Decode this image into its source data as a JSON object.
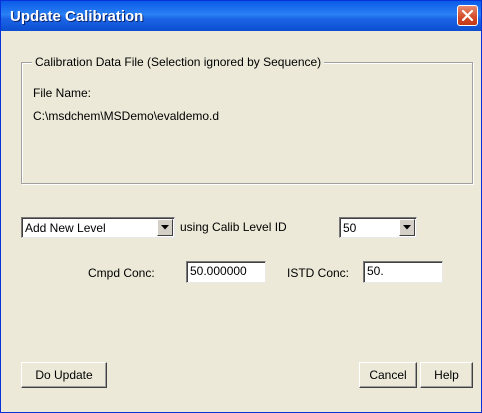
{
  "window": {
    "title": "Update Calibration"
  },
  "file_group": {
    "legend": "Calibration Data File (Selection ignored by Sequence)",
    "file_name_label": "File Name:",
    "file_path": "C:\\msdchem\\MSDemo\\evaldemo.d"
  },
  "level": {
    "action_selected": "Add New Level",
    "using_label": "using Calib Level ID",
    "level_id_selected": "50"
  },
  "concentrations": {
    "cmpd_label": "Cmpd Conc:",
    "cmpd_value": "50.000000",
    "istd_label": "ISTD Conc:",
    "istd_value": "50."
  },
  "buttons": {
    "do_update": "Do Update",
    "cancel": "Cancel",
    "help": "Help"
  },
  "icons": {
    "close": "close-icon",
    "dropdown": "chevron-down-icon"
  },
  "colors": {
    "title_bar": "#0a5be8",
    "dialog_bg": "#ece9d8",
    "close_button": "#d44a28"
  }
}
